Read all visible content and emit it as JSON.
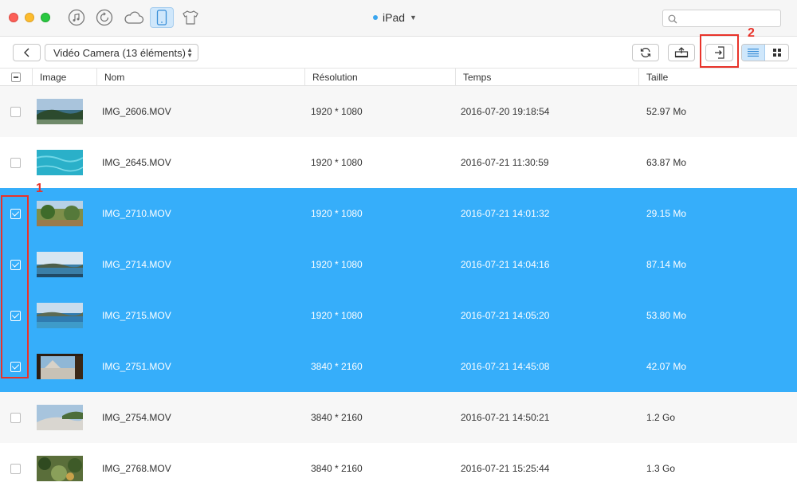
{
  "window": {
    "device_name": "iPad",
    "search_placeholder": ""
  },
  "top_nav": [
    {
      "name": "music-icon"
    },
    {
      "name": "history-icon"
    },
    {
      "name": "icloud-icon"
    },
    {
      "name": "ipad-device-icon",
      "active": true
    },
    {
      "name": "tshirt-icon"
    }
  ],
  "toolbar": {
    "album_label": "Vidéo Camera (13 éléments)",
    "annotation_1": "1",
    "annotation_2": "2"
  },
  "table": {
    "columns": [
      "Image",
      "Nom",
      "Résolution",
      "Temps",
      "Taille"
    ],
    "rows": [
      {
        "name": "IMG_2606.MOV",
        "resolution": "1920 * 1080",
        "time": "2016-07-20 19:18:54",
        "size": "52.97 Mo",
        "selected": false,
        "thumb": "coast"
      },
      {
        "name": "IMG_2645.MOV",
        "resolution": "1920 * 1080",
        "time": "2016-07-21 11:30:59",
        "size": "63.87 Mo",
        "selected": false,
        "thumb": "water"
      },
      {
        "name": "IMG_2710.MOV",
        "resolution": "1920 * 1080",
        "time": "2016-07-21 14:01:32",
        "size": "29.15 Mo",
        "selected": true,
        "thumb": "garden"
      },
      {
        "name": "IMG_2714.MOV",
        "resolution": "1920 * 1080",
        "time": "2016-07-21 14:04:16",
        "size": "87.14 Mo",
        "selected": true,
        "thumb": "sea"
      },
      {
        "name": "IMG_2715.MOV",
        "resolution": "1920 * 1080",
        "time": "2016-07-21 14:05:20",
        "size": "53.80 Mo",
        "selected": true,
        "thumb": "bay"
      },
      {
        "name": "IMG_2751.MOV",
        "resolution": "3840 * 2160",
        "time": "2016-07-21 14:45:08",
        "size": "42.07 Mo",
        "selected": true,
        "thumb": "terrace"
      },
      {
        "name": "IMG_2754.MOV",
        "resolution": "3840 * 2160",
        "time": "2016-07-21 14:50:21",
        "size": "1.2 Go",
        "selected": false,
        "thumb": "hill"
      },
      {
        "name": "IMG_2768.MOV",
        "resolution": "3840 * 2160",
        "time": "2016-07-21 15:25:44",
        "size": "1.3 Go",
        "selected": false,
        "thumb": "plants"
      }
    ]
  },
  "colors": {
    "selection": "#36aefa",
    "annotation": "#e8332a",
    "active_tab": "#cfe7fb"
  }
}
